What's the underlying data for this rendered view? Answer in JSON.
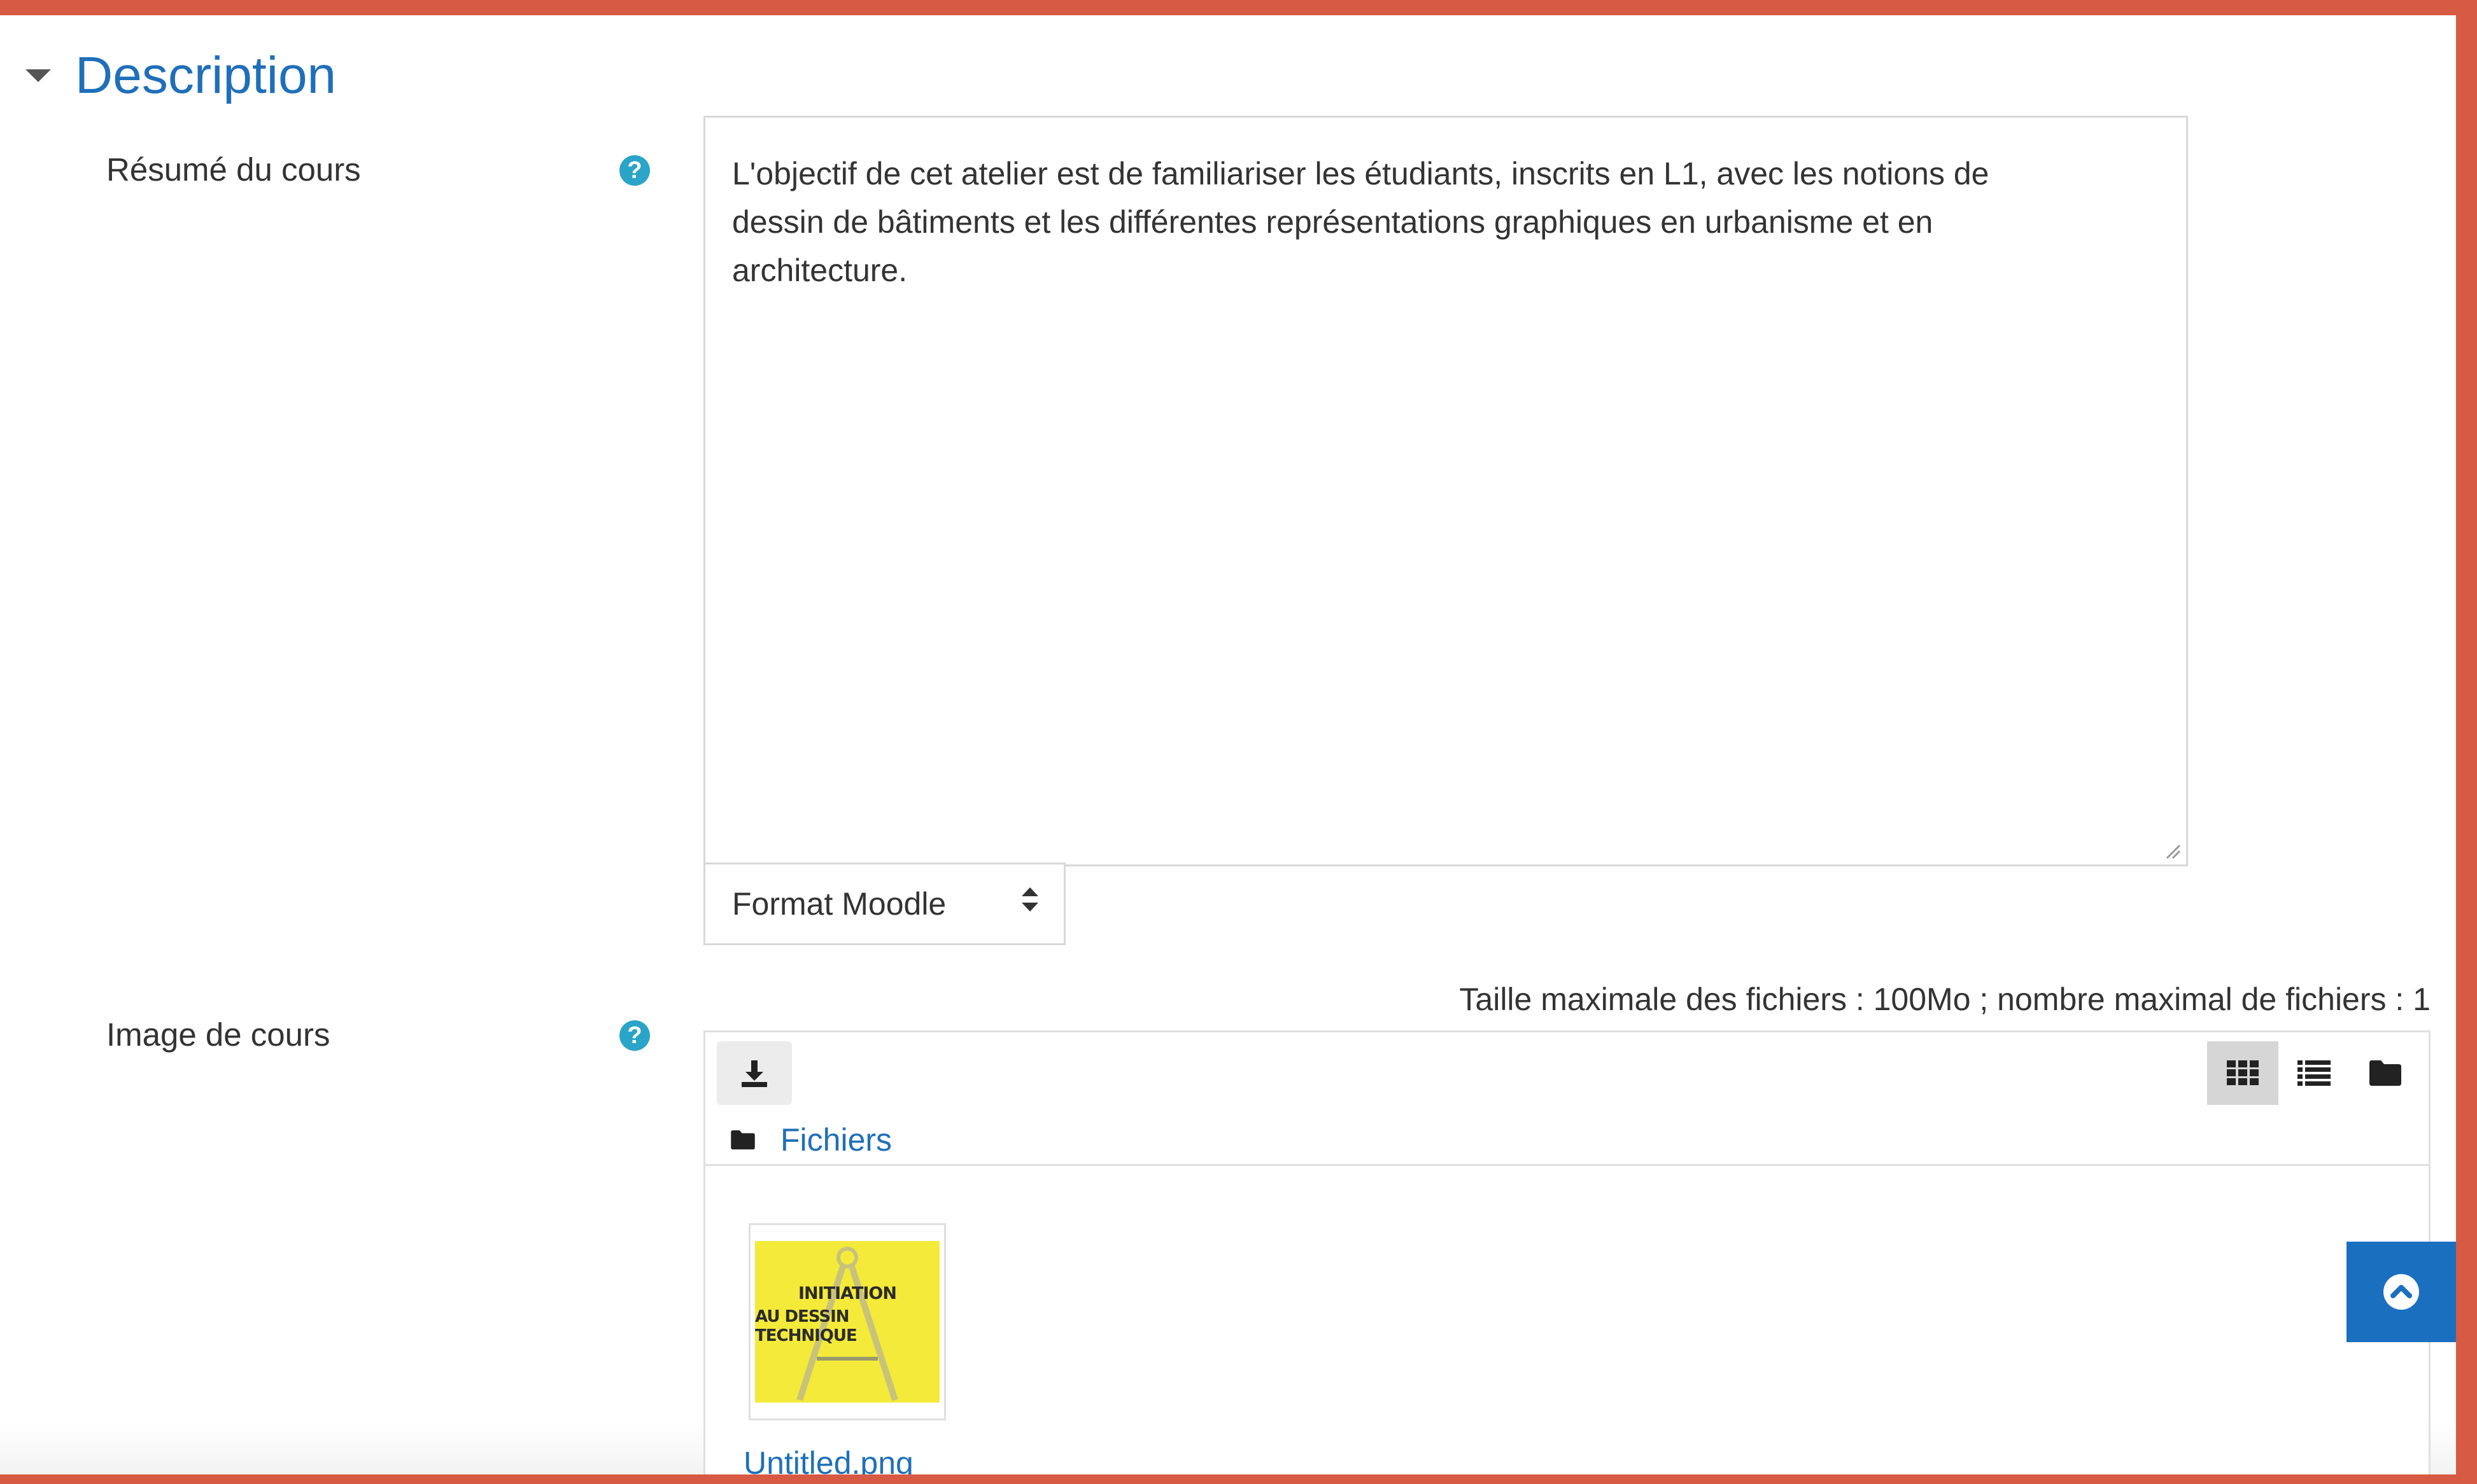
{
  "section": {
    "title": "Description"
  },
  "summary": {
    "label": "Résumé du cours",
    "text_lines": [
      "L'objectif de cet atelier est de familiariser les étudiants, inscrits en L1,  avec les notions de",
      "dessin de bâtiments et les différentes représentations graphiques en urbanisme et en",
      "architecture."
    ],
    "format_select": "Format Moodle"
  },
  "course_image": {
    "label": "Image de cours",
    "limits": "Taille maximale des fichiers : 100Mo ; nombre maximal de fichiers : 1",
    "breadcrumb": "Fichiers",
    "file": {
      "name": "Untitled.png",
      "thumbnail_line1": "INITIATION",
      "thumbnail_line2": "AU DESSIN TECHNIQUE"
    }
  },
  "icons": {
    "help": "question-circle-icon",
    "download": "download-icon",
    "grid_view": "grid-view-icon",
    "list_view": "list-view-icon",
    "tree_view": "folder-view-icon",
    "folder": "folder-icon",
    "scroll_top": "chevron-up-circle-icon"
  },
  "colors": {
    "frame": "#d75a43",
    "link": "#1f6fba",
    "help": "#2aa4c8",
    "scroll_button": "#1b6fbf",
    "thumbnail_bg": "#f3ea3a"
  }
}
